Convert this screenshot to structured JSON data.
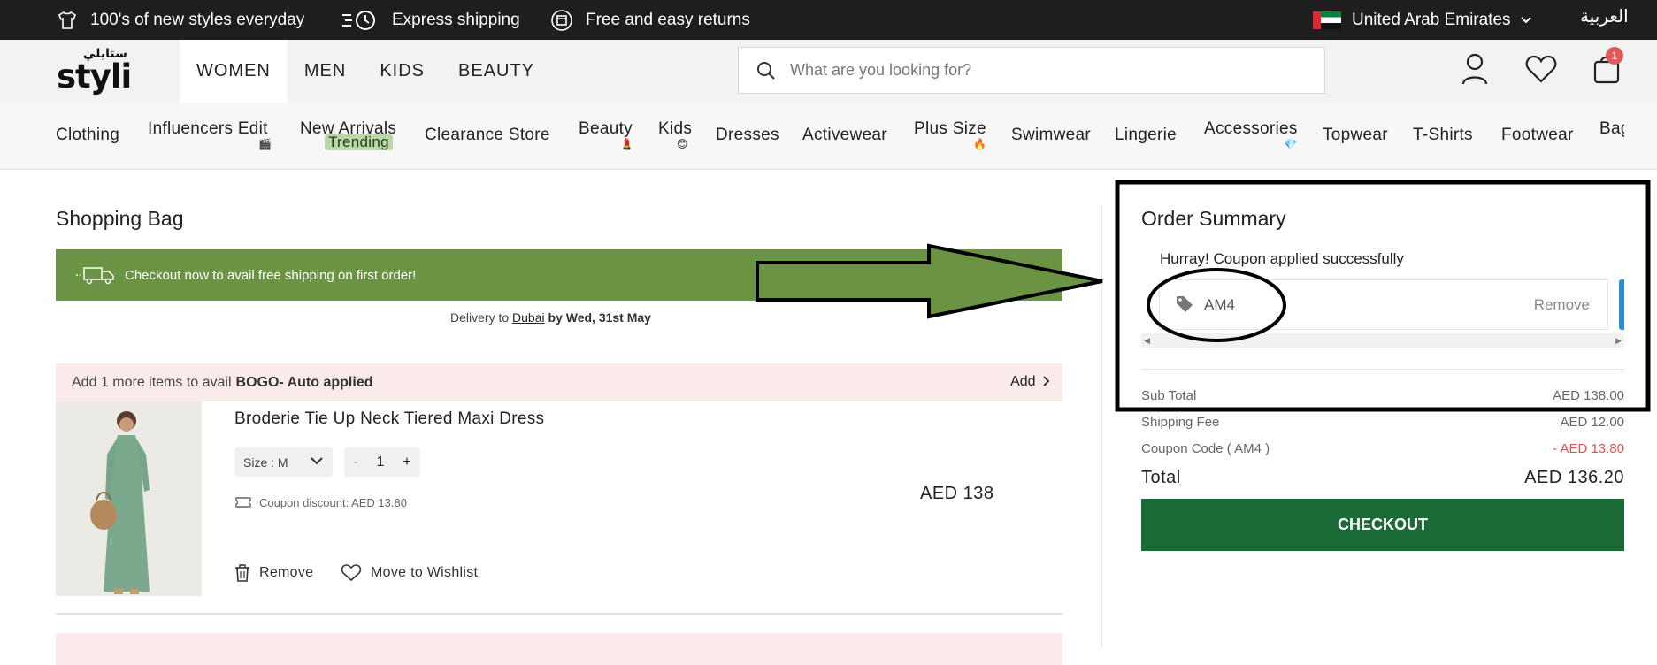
{
  "topbar": {
    "promo1": "100's of new styles everyday",
    "promo2": "Express shipping",
    "promo3": "Free and easy returns",
    "country": "United Arab Emirates",
    "language": "العربية"
  },
  "header": {
    "logo_ar": "ستايلي",
    "logo_en": "styli",
    "tabs": [
      "WOMEN",
      "MEN",
      "KIDS",
      "BEAUTY"
    ],
    "active_tab": "WOMEN",
    "search_placeholder": "What are you looking for?",
    "cart_count": "1"
  },
  "categories": [
    "Clothing",
    "Influencers Edit",
    "New Arrivals",
    "Clearance Store",
    "Beauty",
    "Kids",
    "Dresses",
    "Activewear",
    "Plus Size",
    "Swimwear",
    "Lingerie",
    "Accessories",
    "Topwear",
    "T-Shirts",
    "Footwear",
    "Bag"
  ],
  "trending_tag": "Trending",
  "bag": {
    "title": "Shopping Bag",
    "shipping_banner": "Checkout now to avail free shipping on first order!",
    "delivery_prefix": "Delivery to",
    "delivery_city": "Dubai",
    "delivery_suffix": "by Wed, 31st May",
    "bogo_text": "Add 1 more items to avail",
    "bogo_offer": "BOGO- Auto applied",
    "bogo_action": "Add",
    "item": {
      "name": "Broderie Tie Up Neck Tiered Maxi Dress",
      "size_label": "Size : M",
      "qty_minus": "-",
      "qty": "1",
      "qty_plus": "+",
      "coupon_discount": "Coupon discount: AED 13.80",
      "price": "AED 138",
      "remove": "Remove",
      "wishlist": "Move to Wishlist"
    }
  },
  "summary": {
    "title": "Order Summary",
    "coupon_message": "Hurray! Coupon applied successfully",
    "coupon_code": "AM4",
    "coupon_remove": "Remove",
    "rows": [
      {
        "label": "Sub Total",
        "value": "AED 138.00"
      },
      {
        "label": "Shipping Fee",
        "value": "AED 12.00"
      },
      {
        "label": "Coupon Code ( AM4 )",
        "value": "- AED 13.80"
      }
    ],
    "total_label": "Total",
    "total_value": "AED 136.20",
    "checkout": "CHECKOUT"
  },
  "colors": {
    "topbar": "#1e1e1e",
    "shipping_banner": "#6a9444",
    "checkout": "#1a6b36",
    "bogo_bg": "#fbeaea",
    "discount_red": "#e05252"
  }
}
